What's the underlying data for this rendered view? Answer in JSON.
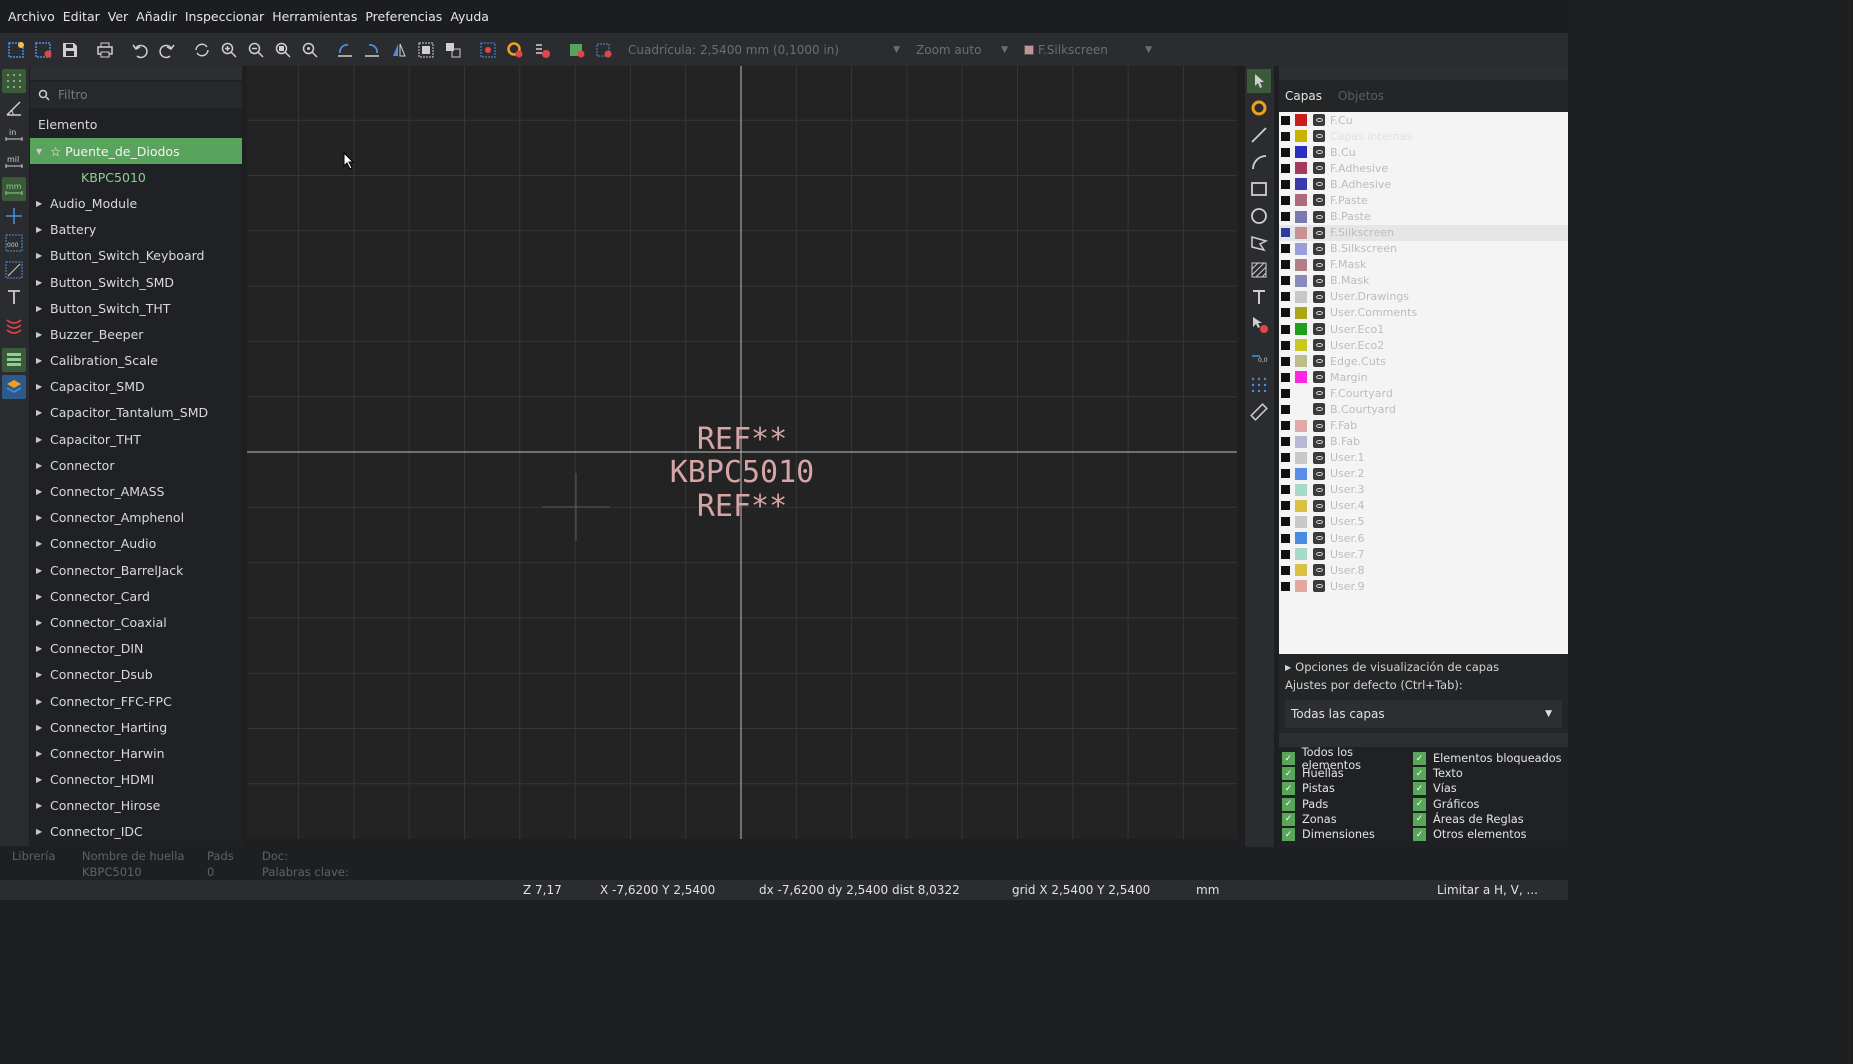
{
  "menu": [
    "Archivo",
    "Editar",
    "Ver",
    "Añadir",
    "Inspeccionar",
    "Herramientas",
    "Preferencias",
    "Ayuda"
  ],
  "toolbar": {
    "grid_label": "Cuadrícula: 2,5400 mm (0,1000 in)",
    "zoom_label": "Zoom auto",
    "layer_label": "F.Silkscreen",
    "layer_color": "#c89294"
  },
  "lefttool_labels": {
    "inch": "in",
    "mil": "mil",
    "mm": "mm"
  },
  "library": {
    "filter_placeholder": "Filtro",
    "column": "Elemento",
    "selected": "☆ Puente_de_Diodos",
    "child": "KBPC5010",
    "items": [
      "Audio_Module",
      "Battery",
      "Button_Switch_Keyboard",
      "Button_Switch_SMD",
      "Button_Switch_THT",
      "Buzzer_Beeper",
      "Calibration_Scale",
      "Capacitor_SMD",
      "Capacitor_Tantalum_SMD",
      "Capacitor_THT",
      "Connector",
      "Connector_AMASS",
      "Connector_Amphenol",
      "Connector_Audio",
      "Connector_BarrelJack",
      "Connector_Card",
      "Connector_Coaxial",
      "Connector_DIN",
      "Connector_Dsub",
      "Connector_FFC-FPC",
      "Connector_Harting",
      "Connector_Harwin",
      "Connector_HDMI",
      "Connector_Hirose",
      "Connector_IDC"
    ]
  },
  "canvas": {
    "ref_top": "REF**",
    "value": "KBPC5010",
    "ref_bottom": "REF**",
    "text_color": "#d7a5a6"
  },
  "layers": {
    "tabs": [
      "Capas",
      "Objetos"
    ],
    "active": "F.Silkscreen",
    "items": [
      {
        "name": "F.Cu",
        "color": "#c81e1e"
      },
      {
        "name": "Capas internas",
        "color": "#c8b400"
      },
      {
        "name": "B.Cu",
        "color": "#2b2fc0"
      },
      {
        "name": "F.Adhesive",
        "color": "#a33a5b"
      },
      {
        "name": "B.Adhesive",
        "color": "#3a3aa8"
      },
      {
        "name": "F.Paste",
        "color": "#b06a7c"
      },
      {
        "name": "B.Paste",
        "color": "#7a7ab0"
      },
      {
        "name": "F.Silkscreen",
        "color": "#c89294"
      },
      {
        "name": "B.Silkscreen",
        "color": "#9c9cd6"
      },
      {
        "name": "F.Mask",
        "color": "#b07f88"
      },
      {
        "name": "B.Mask",
        "color": "#8a8ab8"
      },
      {
        "name": "User.Drawings",
        "color": "#c8c8c8"
      },
      {
        "name": "User.Comments",
        "color": "#a7a718"
      },
      {
        "name": "User.Eco1",
        "color": "#1ea01e"
      },
      {
        "name": "User.Eco2",
        "color": "#c8c820"
      },
      {
        "name": "Edge.Cuts",
        "color": "#bcbc8c"
      },
      {
        "name": "Margin",
        "color": "#ff26e2"
      },
      {
        "name": "F.Courtyard",
        "color": "#f4f4f4"
      },
      {
        "name": "B.Courtyard",
        "color": "#f4f4f4"
      },
      {
        "name": "F.Fab",
        "color": "#e0a8a8"
      },
      {
        "name": "B.Fab",
        "color": "#b8b8d0"
      },
      {
        "name": "User.1",
        "color": "#c8c8c8"
      },
      {
        "name": "User.2",
        "color": "#5a8ee6"
      },
      {
        "name": "User.3",
        "color": "#a8d8c8"
      },
      {
        "name": "User.4",
        "color": "#d8c040"
      },
      {
        "name": "User.5",
        "color": "#c8c8c8"
      },
      {
        "name": "User.6",
        "color": "#4a8ae0"
      },
      {
        "name": "User.7",
        "color": "#a8d8c8"
      },
      {
        "name": "User.8",
        "color": "#d8c040"
      },
      {
        "name": "User.9",
        "color": "#e0a8a0"
      }
    ],
    "display_options": "Opciones de visualización de capas",
    "preset_label": "Ajustes por defecto (Ctrl+Tab):",
    "preset_value": "Todas las capas"
  },
  "objects": {
    "col1": [
      "Todos los elementos",
      "Huellas",
      "Pistas",
      "Pads",
      "Zonas",
      "Dimensiones"
    ],
    "col2": [
      "Elementos bloqueados",
      "Texto",
      "Vías",
      "Gráficos",
      "Áreas de Reglas",
      "Otros elementos"
    ]
  },
  "info": {
    "lib_h": "Librería",
    "name_h": "Nombre de huella",
    "name_v": "KBPC5010",
    "pads_h": "Pads",
    "pads_v": "0",
    "doc_h": "Doc:",
    "kw_h": "Palabras clave:"
  },
  "status": {
    "zoom": "Z 7,17",
    "xy": "X -7,6200  Y 2,5400",
    "delta": "dx -7,6200  dy 2,5400  dist 8,0322",
    "grid": "grid X 2,5400  Y 2,5400",
    "units": "mm",
    "constraint": "Limitar a H, V, ..."
  }
}
